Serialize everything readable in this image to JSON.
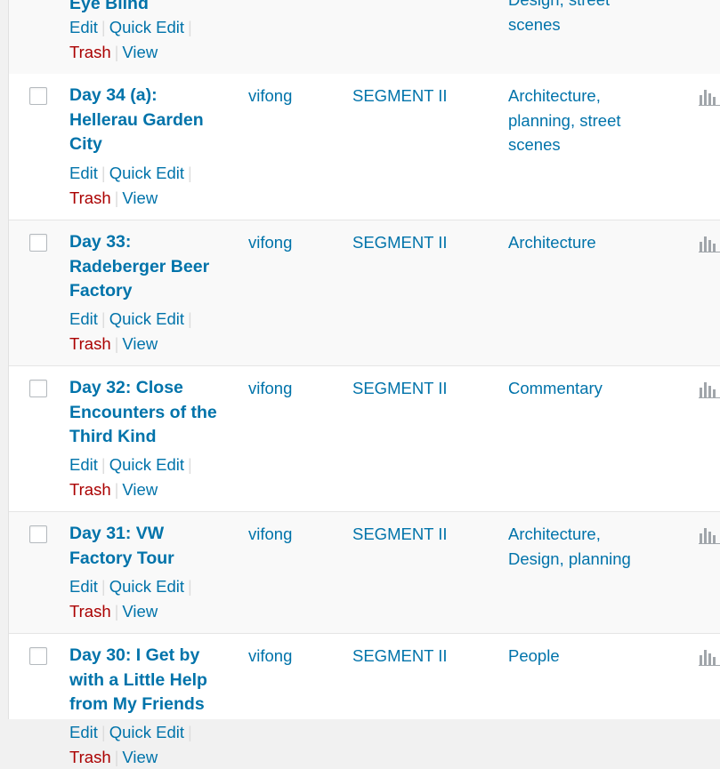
{
  "separator": "|",
  "rows": [
    {
      "title": "Eye Blind",
      "author": "",
      "segment": "",
      "categories": "Design, street scenes",
      "actions": {
        "edit": "Edit",
        "quick_edit": "Quick Edit",
        "trash": "Trash",
        "view": "View"
      }
    },
    {
      "title": "Day 34 (a): Hellerau Garden City",
      "author": "vifong",
      "segment": "SEGMENT II",
      "categories": "Architecture, planning, street scenes",
      "actions": {
        "edit": "Edit",
        "quick_edit": "Quick Edit",
        "trash": "Trash",
        "view": "View"
      }
    },
    {
      "title": "Day 33: Radeberger Beer Factory",
      "author": "vifong",
      "segment": "SEGMENT II",
      "categories": "Architecture",
      "actions": {
        "edit": "Edit",
        "quick_edit": "Quick Edit",
        "trash": "Trash",
        "view": "View"
      }
    },
    {
      "title": "Day 32: Close Encounters of the Third Kind",
      "author": "vifong",
      "segment": "SEGMENT II",
      "categories": "Commentary",
      "actions": {
        "edit": "Edit",
        "quick_edit": "Quick Edit",
        "trash": "Trash",
        "view": "View"
      }
    },
    {
      "title": "Day 31: VW Factory Tour",
      "author": "vifong",
      "segment": "SEGMENT II",
      "categories": "Architecture, Design, planning",
      "actions": {
        "edit": "Edit",
        "quick_edit": "Quick Edit",
        "trash": "Trash",
        "view": "View"
      }
    },
    {
      "title": "Day 30: I Get by with a Little Help from My Friends",
      "author": "vifong",
      "segment": "SEGMENT II",
      "categories": "People",
      "actions": {
        "edit": "Edit",
        "quick_edit": "Quick Edit",
        "trash": "Trash",
        "view": "View"
      }
    }
  ],
  "colors": {
    "link": "#0073aa",
    "trash": "#aa0000",
    "row_alt": "#f9f9f9",
    "row_plain": "#ffffff"
  },
  "icons": {
    "checkbox": "checkbox",
    "stats": "stats-bar-chart-icon"
  }
}
